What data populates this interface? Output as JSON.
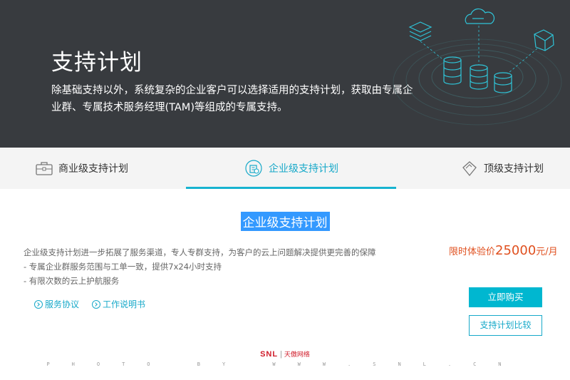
{
  "hero": {
    "title": "支持计划",
    "description": "除基础支持以外，系统复杂的企业客户可以选择适用的支持计划，获取由专属企业群、专属技术服务经理(TAM)等组成的专属支持。"
  },
  "tabs": [
    {
      "label": "商业级支持计划",
      "icon": "briefcase-icon",
      "active": false
    },
    {
      "label": "企业级支持计划",
      "icon": "enterprise-icon",
      "active": true
    },
    {
      "label": "顶级支持计划",
      "icon": "diamond-icon",
      "active": false
    }
  ],
  "plan": {
    "title": "企业级支持计划",
    "description_lines": [
      "企业级支持计划进一步拓展了服务渠道，专人专群支持，为客户的云上问题解决提供更完善的保障",
      "- 专属企业群服务范围与工单一致，提供7x24小时支持",
      "- 有限次数的云上护航服务"
    ],
    "links": [
      {
        "label": "服务协议",
        "icon": "arrow-circle-icon"
      },
      {
        "label": "工作说明书",
        "icon": "arrow-circle-icon"
      }
    ],
    "price_prefix": "限时体验价",
    "price_amount": "25000",
    "price_suffix": "元/月",
    "buy_label": "立即购买",
    "compare_label": "支持计划比较"
  },
  "watermark": {
    "logo": "SNL",
    "separator": "|",
    "brand": "天傲网络",
    "line": "PHOTO BY WWW.SNL.CN"
  },
  "colors": {
    "hero_bg": "#383b3f",
    "accent": "#17b3d0",
    "price": "#e0501f",
    "selection": "#3399ff"
  }
}
